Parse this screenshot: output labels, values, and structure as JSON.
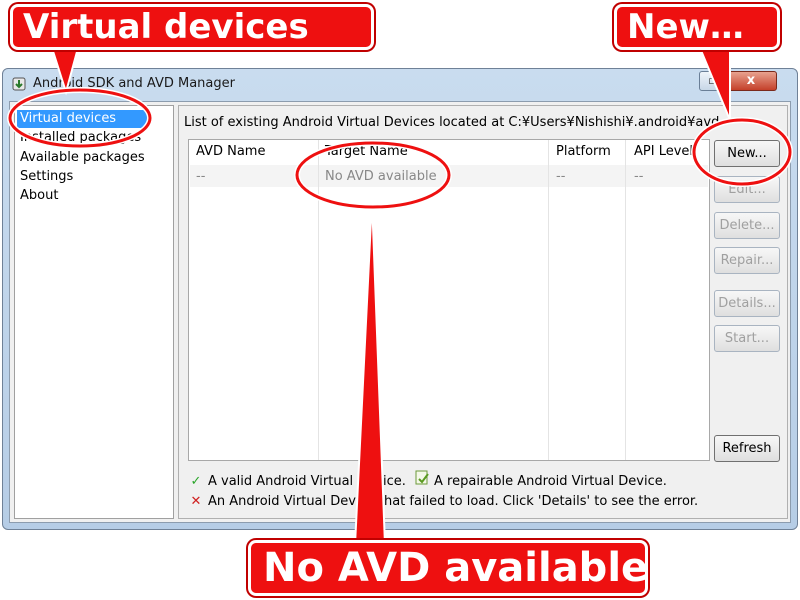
{
  "window": {
    "title": "Android SDK and AVD Manager",
    "close_glyph": "x",
    "minimize_glyph": "▫"
  },
  "sidebar": {
    "items": [
      {
        "label": "Virtual devices",
        "selected": true
      },
      {
        "label": "Installed packages",
        "selected": false
      },
      {
        "label": "Available packages",
        "selected": false
      },
      {
        "label": "Settings",
        "selected": false
      },
      {
        "label": "About",
        "selected": false
      }
    ]
  },
  "main": {
    "caption": "List of existing Android Virtual Devices located at C:¥Users¥Nishishi¥.android¥avd",
    "columns": [
      "AVD Name",
      "Target Name",
      "Platform",
      "API Level"
    ],
    "row": [
      "--",
      "No AVD available",
      "--",
      "--"
    ]
  },
  "buttons": {
    "new": "New...",
    "edit": "Edit...",
    "delete": "Delete...",
    "repair": "Repair...",
    "details": "Details...",
    "start": "Start...",
    "refresh": "Refresh"
  },
  "legend": {
    "valid": "A valid Android Virtual Device.",
    "repairable": "A repairable Android Virtual Device.",
    "failed": "An Android Virtual Device that failed to load. Click 'Details' to see the error.",
    "valid_icon": "check-icon",
    "repairable_icon": "repair-icon",
    "failed_icon": "cross-icon"
  },
  "callouts": {
    "virtual_devices": "Virtual devices",
    "new": "New…",
    "no_avd": "No AVD available"
  },
  "colors": {
    "callout": "#ee1010",
    "selection": "#3399ff",
    "check": "#2aa52a",
    "cross": "#d02020"
  }
}
